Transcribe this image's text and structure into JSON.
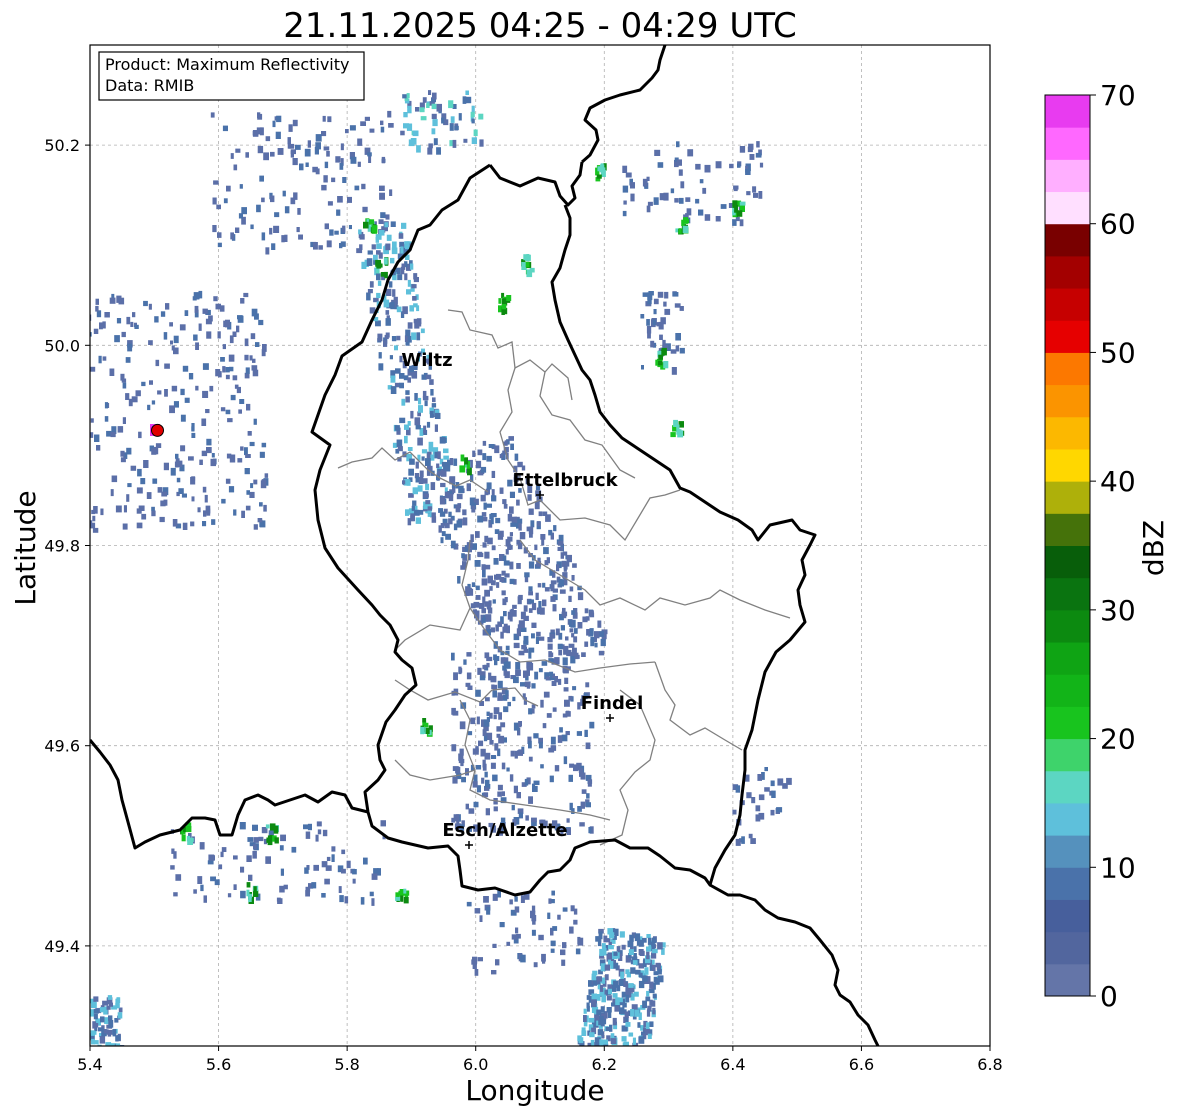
{
  "title": "21.11.2025 04:25 - 04:29 UTC",
  "info_box": {
    "product": "Product: Maximum Reflectivity",
    "source": "Data: RMIB"
  },
  "axes": {
    "xlabel": "Longitude",
    "ylabel": "Latitude",
    "xlim": [
      5.4,
      6.8
    ],
    "ylim": [
      49.3,
      50.3
    ],
    "xticks": [
      "5.4",
      "5.6",
      "5.8",
      "6.0",
      "6.2",
      "6.4",
      "6.6",
      "6.8"
    ],
    "yticks": [
      "49.4",
      "49.6",
      "49.8",
      "50.0",
      "50.2"
    ],
    "grid": true
  },
  "cities": [
    {
      "name": "Wiltz",
      "lon": 5.93,
      "lat": 49.97
    },
    {
      "name": "Ettelbruck",
      "lon": 6.1,
      "lat": 49.85
    },
    {
      "name": "Findel",
      "lon": 6.21,
      "lat": 49.63
    },
    {
      "name": "Esch/Alzette",
      "lon": 5.99,
      "lat": 49.5
    }
  ],
  "radar_marker": {
    "lon": 5.505,
    "lat": 49.915,
    "color": "#e00000"
  },
  "colorbar": {
    "label": "dBZ",
    "ticks": [
      "0",
      "10",
      "20",
      "30",
      "40",
      "50",
      "60",
      "70"
    ],
    "range": [
      0,
      70
    ],
    "colors": [
      "#6475a8",
      "#52669e",
      "#475f9c",
      "#4a72aa",
      "#5591bd",
      "#5ec0db",
      "#5cd6c2",
      "#3ed36b",
      "#18c41e",
      "#12b418",
      "#0fa414",
      "#0c8a10",
      "#0a7410",
      "#085e0a",
      "#45720a",
      "#aeb00a",
      "#ffd700",
      "#fcb800",
      "#fb9400",
      "#fc7800",
      "#e60000",
      "#c60000",
      "#a30000",
      "#790000",
      "#ffdfff",
      "#ffafff",
      "#ff68ff",
      "#e83bf0"
    ]
  },
  "echo_colors": {
    "light": "#5b6fa8",
    "mid": "#4a72aa",
    "cyan": "#5ec0db",
    "teal": "#5cd6c2",
    "green": "#18c41e",
    "dark_green": "#0c8a10",
    "magenta": "#e83bf0"
  }
}
